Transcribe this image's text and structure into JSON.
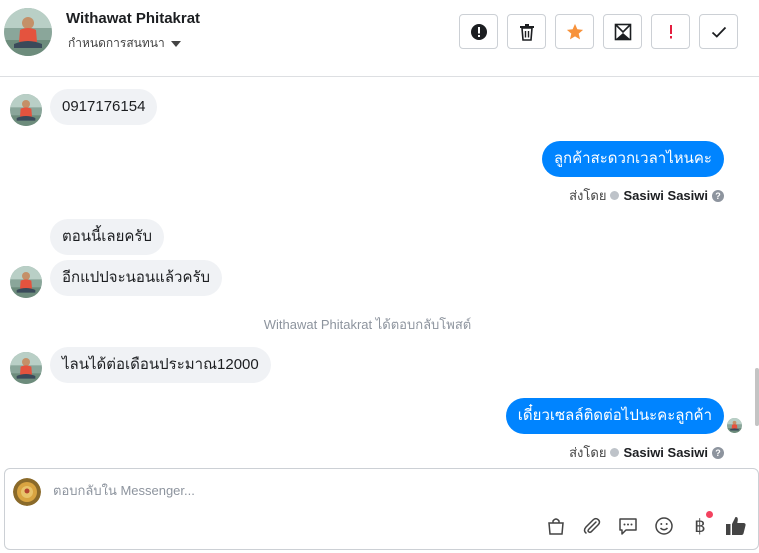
{
  "header": {
    "name": "Withawat Phitakrat",
    "subtitle": "กำหนดการสนทนา"
  },
  "actions": [
    {
      "name": "report-icon",
      "glyph": "!"
    },
    {
      "name": "trash-icon"
    },
    {
      "name": "star-icon"
    },
    {
      "name": "archive-icon"
    },
    {
      "name": "spam-icon",
      "glyph": "!"
    },
    {
      "name": "check-icon"
    }
  ],
  "messages": {
    "m1": "0917176154",
    "m2": "ลูกค้าสะดวกเวลาไหนคะ",
    "sent_label": "ส่งโดย",
    "agent": "Sasiwi Sasiwi",
    "m3a": "ตอนนี้เลยครับ",
    "m3b": "อีกแปปจะนอนแล้วครับ",
    "system_note": "Withawat Phitakrat ได้ตอบกลับโพสต์",
    "m4": "ไลนได้ต่อเดือนประมาณ12000",
    "m5": "เดี๋ยวเซลล์ติดต่อไปนะคะลูกค้า",
    "help_glyph": "?"
  },
  "composer": {
    "placeholder": "ตอบกลับใน Messenger...",
    "baht_glyph": "฿"
  },
  "colors": {
    "accent": "#0084ff",
    "star": "#f7923b",
    "danger": "#e41e3f"
  }
}
